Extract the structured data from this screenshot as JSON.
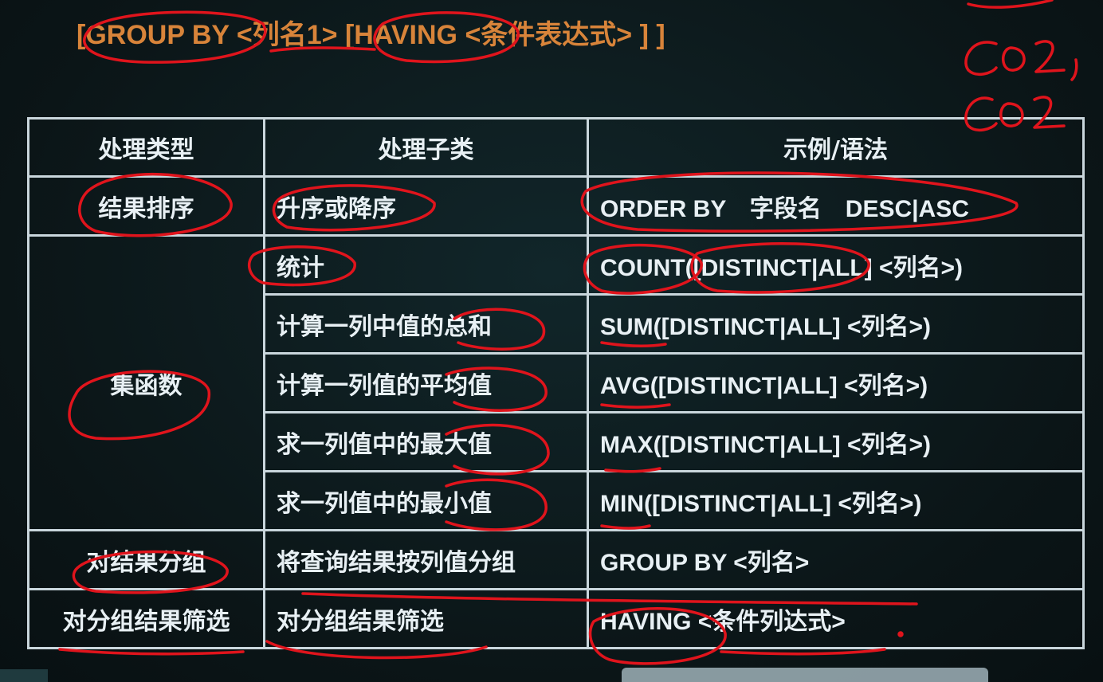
{
  "syntax": {
    "line": "[GROUP BY <列名1> [HAVING <条件表达式> ] ]"
  },
  "margin_notes": {
    "lines": [
      "CO2 ,",
      "CO2 ,"
    ]
  },
  "table": {
    "headers": [
      "处理类型",
      "处理子类",
      "示例/语法"
    ],
    "rows": [
      {
        "category": "结果排序",
        "subclass": "升序或降序",
        "example": "ORDER BY　字段名　DESC|ASC"
      },
      {
        "category": "集函数",
        "subclass": "统计",
        "example": "COUNT([DISTINCT|ALL] <列名>)"
      },
      {
        "subclass": "计算一列中值的总和",
        "example": "SUM([DISTINCT|ALL] <列名>)"
      },
      {
        "subclass": "计算一列值的平均值",
        "example": "AVG([DISTINCT|ALL] <列名>)"
      },
      {
        "subclass": "求一列值中的最大值",
        "example": "MAX([DISTINCT|ALL] <列名>)"
      },
      {
        "subclass": "求一列值中的最小值",
        "example": "MIN([DISTINCT|ALL] <列名>)"
      },
      {
        "category": "对结果分组",
        "subclass": "将查询结果按列值分组",
        "example": "GROUP BY <列名>"
      },
      {
        "category": "对分组结果筛选",
        "subclass": "对分组结果筛选",
        "example": "HAVING <条件列达式>"
      }
    ]
  },
  "colors": {
    "background": "#0d1a1c",
    "table_text": "#e8f0f4",
    "syntax_text": "#d8843a",
    "ink": "#e0141c"
  }
}
